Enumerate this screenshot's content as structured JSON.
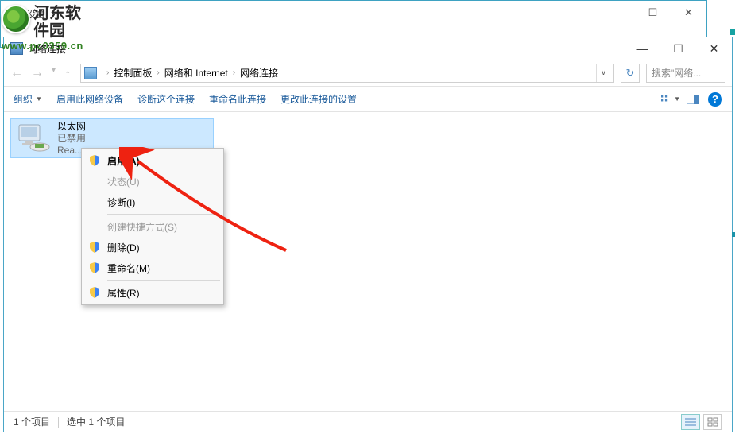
{
  "bgwin": {
    "title": "设置",
    "min": "—",
    "max": "☐",
    "close": "✕"
  },
  "watermark": {
    "line1": "河东软件园",
    "line2": "www.pc0359.cn"
  },
  "fgwin": {
    "title": "网络连接",
    "min": "—",
    "max": "☐",
    "close": "✕"
  },
  "breadcrumb": {
    "p1": "控制面板",
    "p2": "网络和 Internet",
    "p3": "网络连接"
  },
  "search": {
    "placeholder": "搜索\"网络..."
  },
  "toolbar": {
    "organize": "组织",
    "enable": "启用此网络设备",
    "diagnose": "诊断这个连接",
    "rename": "重命名此连接",
    "change": "更改此连接的设置"
  },
  "adapter": {
    "name": "以太网",
    "status": "已禁用",
    "device": "Rea..."
  },
  "menu": {
    "enable": "启用(A)",
    "status": "状态(U)",
    "diagnose": "诊断(I)",
    "shortcut": "创建快捷方式(S)",
    "delete": "删除(D)",
    "rename": "重命名(M)",
    "properties": "属性(R)"
  },
  "statusbar": {
    "count": "1 个项目",
    "selected": "选中 1 个项目"
  }
}
